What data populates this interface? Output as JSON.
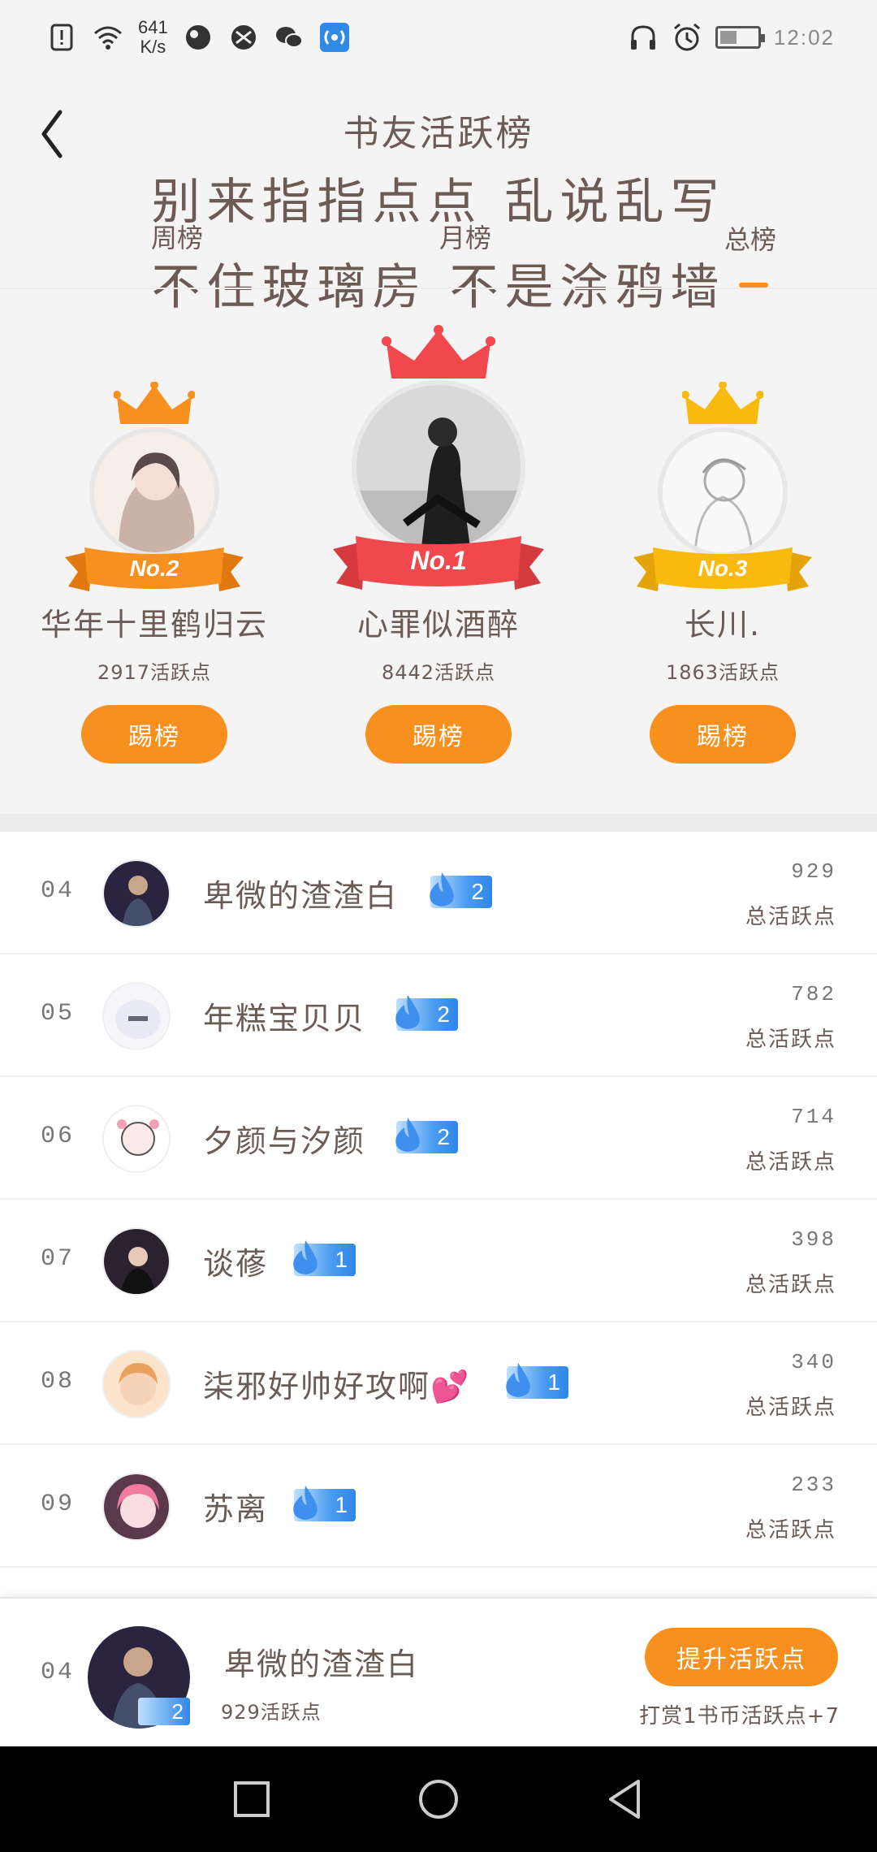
{
  "status_bar": {
    "net_speed_value": "641",
    "net_speed_unit": "K/s",
    "time": "12:02",
    "battery_level": 0.45,
    "left_icons": [
      "alert-icon",
      "wifi-icon",
      "app-icon-1",
      "app-icon-2",
      "wechat-icon",
      "hotspot-icon"
    ],
    "right_icons": [
      "headset-icon",
      "alarm-icon",
      "battery-icon"
    ]
  },
  "header": {
    "title": "书友活跃榜",
    "slogan_line1": "别来指指点点 乱说乱写",
    "slogan_line2": "不住玻璃房 不是涂鸦墙",
    "tabs": [
      {
        "label": "周榜",
        "active": false
      },
      {
        "label": "月榜",
        "active": false
      },
      {
        "label": "总榜",
        "active": true
      }
    ]
  },
  "podium": [
    {
      "rank_label": "No.2",
      "name": "华年十里鹤归云",
      "points": "2917活跃点",
      "button": "踢榜",
      "crown_color": "#f7901e",
      "ribbon_color": "#f7901e"
    },
    {
      "rank_label": "No.1",
      "name": "心罪似酒醉",
      "points": "8442活跃点",
      "button": "踢榜",
      "crown_color": "#f0484d",
      "ribbon_color": "#f0484d"
    },
    {
      "rank_label": "No.3",
      "name": "长川.",
      "points": "1863活跃点",
      "button": "踢榜",
      "crown_color": "#f9b90f",
      "ribbon_color": "#f9b90f"
    }
  ],
  "list": [
    {
      "rank": "04",
      "name": "卑微的渣渣白",
      "level": "2",
      "score": "929",
      "score_label": "总活跃点"
    },
    {
      "rank": "05",
      "name": "年糕宝贝贝",
      "level": "2",
      "score": "782",
      "score_label": "总活跃点"
    },
    {
      "rank": "06",
      "name": "夕颜与汐颜",
      "level": "2",
      "score": "714",
      "score_label": "总活跃点"
    },
    {
      "rank": "07",
      "name": "谈蓚",
      "level": "1",
      "score": "398",
      "score_label": "总活跃点"
    },
    {
      "rank": "08",
      "name": "柒邪好帅好攻啊💕",
      "level": "1",
      "score": "340",
      "score_label": "总活跃点"
    },
    {
      "rank": "09",
      "name": "苏离",
      "level": "1",
      "score": "233",
      "score_label": "总活跃点"
    }
  ],
  "my_rank": {
    "rank": "04",
    "name": "卑微的渣渣白",
    "level": "2",
    "points": "929活跃点",
    "boost_button": "提升活跃点",
    "tip": "打赏1书币活跃点+7"
  },
  "colors": {
    "accent": "#f7901e",
    "badge_blue": "#2f86e8",
    "text": "#6b5b56"
  }
}
